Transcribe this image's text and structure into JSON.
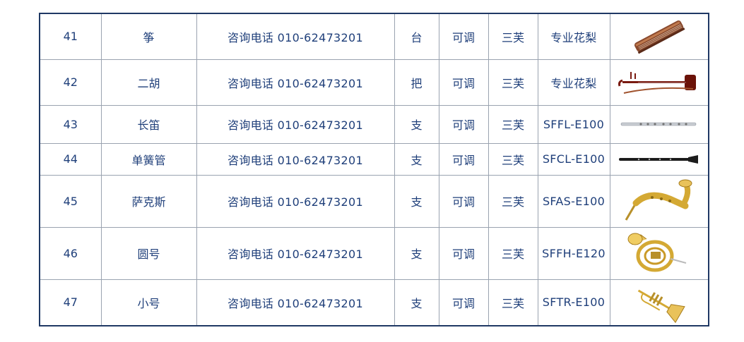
{
  "rows": [
    {
      "no": "41",
      "name": "筝",
      "price": "咨询电话 010-62473201",
      "unit": "台",
      "spec": "可调",
      "brand": "三芙",
      "model": "专业花梨",
      "icon": "guzheng-icon"
    },
    {
      "no": "42",
      "name": "二胡",
      "price": "咨询电话 010-62473201",
      "unit": "把",
      "spec": "可调",
      "brand": "三芙",
      "model": "专业花梨",
      "icon": "erhu-icon"
    },
    {
      "no": "43",
      "name": "长笛",
      "price": "咨询电话 010-62473201",
      "unit": "支",
      "spec": "可调",
      "brand": "三芙",
      "model": "SFFL-E100",
      "icon": "flute-icon"
    },
    {
      "no": "44",
      "name": "单簧管",
      "price": "咨询电话 010-62473201",
      "unit": "支",
      "spec": "可调",
      "brand": "三芙",
      "model": "SFCL-E100",
      "icon": "clarinet-icon"
    },
    {
      "no": "45",
      "name": "萨克斯",
      "price": "咨询电话 010-62473201",
      "unit": "支",
      "spec": "可调",
      "brand": "三芙",
      "model": "SFAS-E100",
      "icon": "saxophone-icon"
    },
    {
      "no": "46",
      "name": "圆号",
      "price": "咨询电话 010-62473201",
      "unit": "支",
      "spec": "可调",
      "brand": "三芙",
      "model": "SFFH-E120",
      "icon": "french-horn-icon"
    },
    {
      "no": "47",
      "name": "小号",
      "price": "咨询电话 010-62473201",
      "unit": "支",
      "spec": "可调",
      "brand": "三芙",
      "model": "SFTR-E100",
      "icon": "trumpet-icon"
    }
  ]
}
